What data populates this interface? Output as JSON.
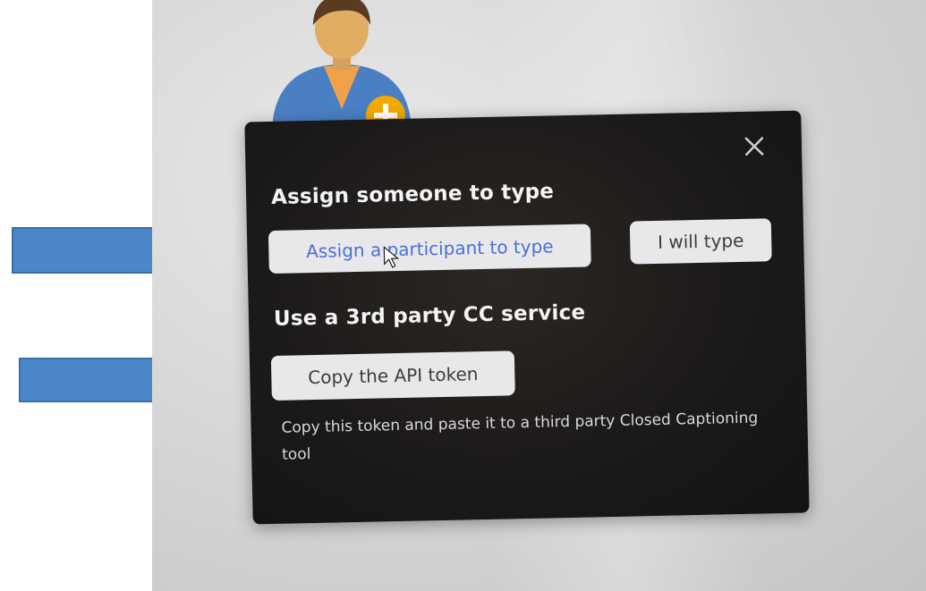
{
  "dialog": {
    "assign_heading": "Assign someone to type",
    "assign_participant_label": "Assign a participant to type",
    "self_type_label": "I will type",
    "cc_heading": "Use a 3rd party CC service",
    "copy_token_label": "Copy the API token",
    "helper_text": "Copy this token and paste it to a third party Closed Captioning tool"
  },
  "icons": {
    "close": "close-icon",
    "avatar": "participant-avatar-icon",
    "add_badge": "add-plus-icon",
    "cursor": "mouse-cursor-icon",
    "annotation_arrow": "right-arrow-icon"
  },
  "colors": {
    "dialog_bg": "#1c1a19",
    "button_bg": "#e8e8ea",
    "assign_button_text": "#4a6fd6",
    "annotation_arrow": "#4a86c8",
    "avatar_body": "#4b7fc4",
    "avatar_badge": "#f2a900"
  }
}
